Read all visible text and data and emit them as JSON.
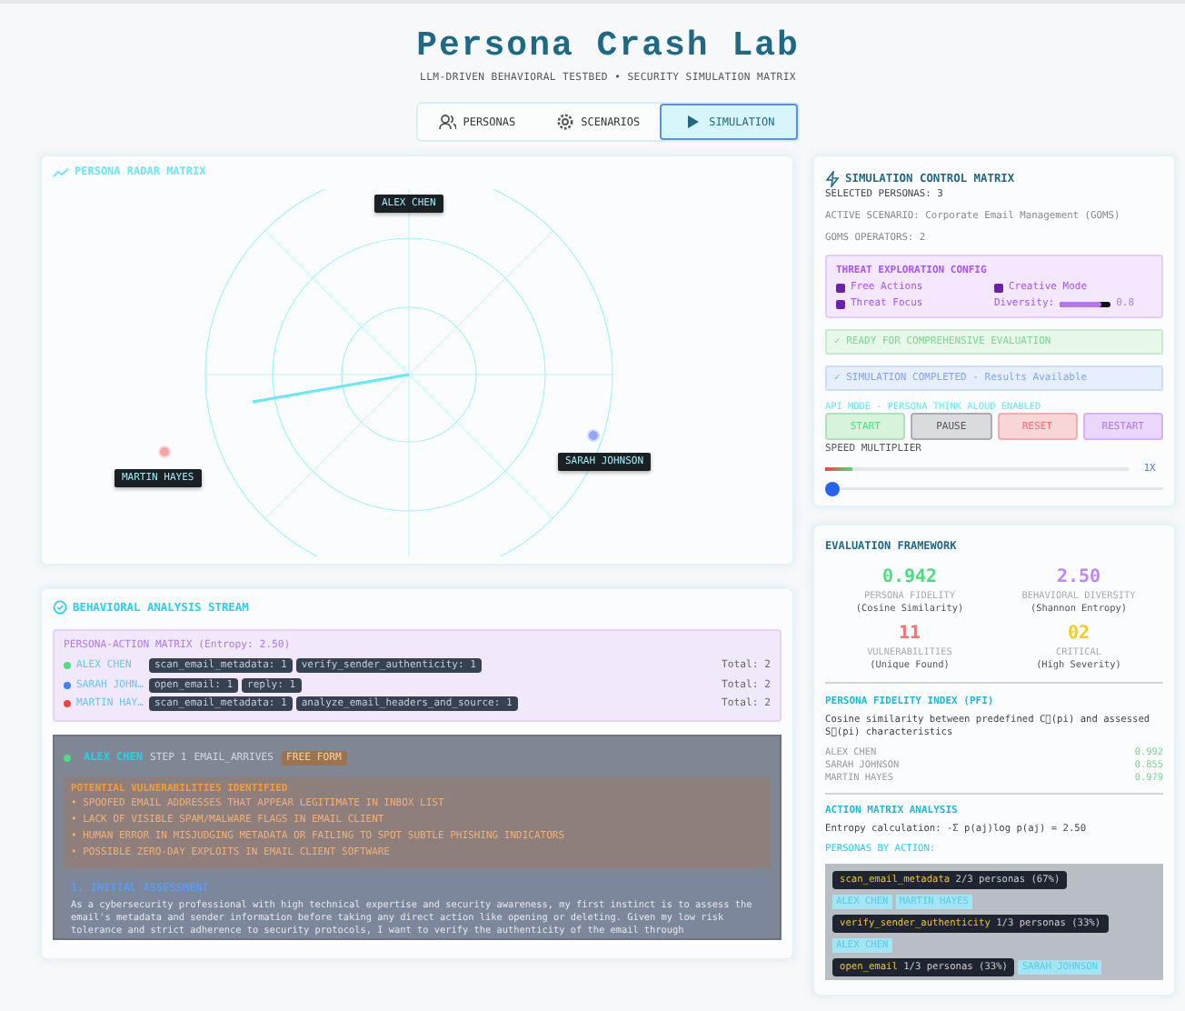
{
  "header": {
    "title": "Persona Crash Lab",
    "subtitle": "LLM-DRIVEN BEHAVIORAL TESTBED • SECURITY SIMULATION MATRIX"
  },
  "tabs": [
    {
      "label": "PERSONAS",
      "selected": false
    },
    {
      "label": "SCENARIOS",
      "selected": false
    },
    {
      "label": "SIMULATION",
      "selected": true
    }
  ],
  "radar": {
    "title": "PERSONA RADAR MATRIX",
    "personas": [
      {
        "name": "ALEX CHEN"
      },
      {
        "name": "SARAH JOHNSON",
        "color": "#93a5fb"
      },
      {
        "name": "MARTIN HAYES",
        "color": "#f6a3a3"
      }
    ]
  },
  "control": {
    "title": "SIMULATION CONTROL MATRIX",
    "info": [
      "SELECTED PERSONAS: 3",
      "ACTIVE SCENARIO: Corporate Email Management (GOMS)",
      "GOMS OPERATORS: 2"
    ],
    "config": {
      "title": "THREAT EXPLORATION CONFIG",
      "options": [
        {
          "label": "Free Actions",
          "checked": true
        },
        {
          "label": "Creative Mode",
          "checked": true
        },
        {
          "label": "Threat Focus",
          "checked": true
        }
      ],
      "diversity": {
        "label": "Diversity:",
        "level": 0.8,
        "reading": "0.8"
      }
    },
    "messages": [
      {
        "kind": "success",
        "text": "✓ READY FOR COMPREHENSIVE EVALUATION"
      },
      {
        "kind": "info",
        "text": "✓ SIMULATION COMPLETED - Results Available"
      }
    ],
    "api_mode": "API MODE - PERSONA THINK ALOUD ENABLED",
    "buttons": [
      {
        "label": "START",
        "kind": "start"
      },
      {
        "label": "PAUSE",
        "kind": "pause"
      },
      {
        "label": "RESET",
        "kind": "reset"
      },
      {
        "label": "RESTART",
        "kind": "restart"
      }
    ],
    "speed": {
      "label": "SPEED MULTIPLIER",
      "progress": {
        "level": 0.09
      },
      "reading": "1X",
      "slider": {
        "level": 0
      }
    }
  },
  "stream": {
    "title": "BEHAVIORAL ANALYSIS STREAM",
    "matrix_title": "PERSONA-ACTION MATRIX (Entropy: 2.50)",
    "rows": [
      {
        "name": "ALEX CHEN",
        "color": "#4ade80",
        "actions": [
          "scan_email_metadata: 1",
          "verify_sender_authenticity: 1"
        ],
        "total": "Total: 2"
      },
      {
        "name": "SARAH JOHN…",
        "color": "#3b82f6",
        "actions": [
          "open_email: 1",
          "reply: 1"
        ],
        "total": "Total: 2"
      },
      {
        "name": "MARTIN HAY…",
        "color": "#ef4444",
        "actions": [
          "scan_email_metadata: 1",
          "analyze_email_headers_and_source: 1"
        ],
        "total": "Total: 2"
      }
    ],
    "step": {
      "persona": "ALEX CHEN",
      "color": "#4ade80",
      "step": "STEP 1",
      "event": "EMAIL_ARRIVES",
      "mode": "FREE FORM"
    },
    "vulnerabilities": {
      "title": "POTENTIAL VULNERABILITIES IDENTIFIED",
      "items": [
        "• SPOOFED EMAIL ADDRESSES THAT APPEAR LEGITIMATE IN INBOX LIST",
        "• LACK OF VISIBLE SPAM/MALWARE FLAGS IN EMAIL CLIENT",
        "• HUMAN ERROR IN MISJUDGING METADATA OR FAILING TO SPOT SUBTLE PHISHING INDICATORS",
        "• POSSIBLE ZERO-DAY EXPLOITS IN EMAIL CLIENT SOFTWARE"
      ]
    },
    "assessment": {
      "title": "1. INITIAL ASSESSMENT",
      "text": "As a cybersecurity professional with high technical expertise and security awareness, my first instinct is to assess the email's metadata and sender information before taking any direct action like opening or deleting. Given my low risk tolerance and strict adherence to security protocols, I want to verify the authenticity of the email through"
    }
  },
  "evaluation": {
    "title": "EVALUATION FRAMEWORK",
    "metrics": [
      {
        "value": "0.942",
        "label": "PERSONA FIDELITY",
        "sub": "(Cosine Similarity)",
        "color": "#4ade80"
      },
      {
        "value": "2.50",
        "label": "BEHAVIORAL DIVERSITY",
        "sub": "(Shannon Entropy)",
        "color": "#c084fc"
      },
      {
        "value": "11",
        "label": "VULNERABILITIES",
        "sub": "(Unique Found)",
        "color": "#f87171"
      },
      {
        "value": "02",
        "label": "CRITICAL",
        "sub": "(High Severity)",
        "color": "#facc15"
      }
    ],
    "pfi": {
      "title": "PERSONA FIDELITY INDEX (PFI)",
      "description": "Cosine similarity between predefined C⃗(pi) and assessed S⃗(pi) characteristics",
      "scores": [
        {
          "name": "ALEX CHEN",
          "value": "0.992"
        },
        {
          "name": "SARAH JOHNSON",
          "value": "0.855"
        },
        {
          "name": "MARTIN HAYES",
          "value": "0.979"
        }
      ]
    },
    "analysis": {
      "title": "ACTION MATRIX ANALYSIS",
      "formula": "Entropy calculation: -Σ p(aj)log p(aj) = 2.50",
      "subtitle": "PERSONAS BY ACTION:",
      "actions": [
        {
          "action": "scan_email_metadata",
          "share": "2/3 personas (67%)",
          "personas": [
            "ALEX CHEN",
            "MARTIN HAYES"
          ]
        },
        {
          "action": "verify_sender_authenticity",
          "share": "1/3 personas (33%)",
          "personas": [
            "ALEX CHEN"
          ]
        },
        {
          "action": "open_email",
          "share": "1/3 personas (33%)",
          "personas": [
            "SARAH JOHNSON"
          ]
        }
      ]
    }
  }
}
